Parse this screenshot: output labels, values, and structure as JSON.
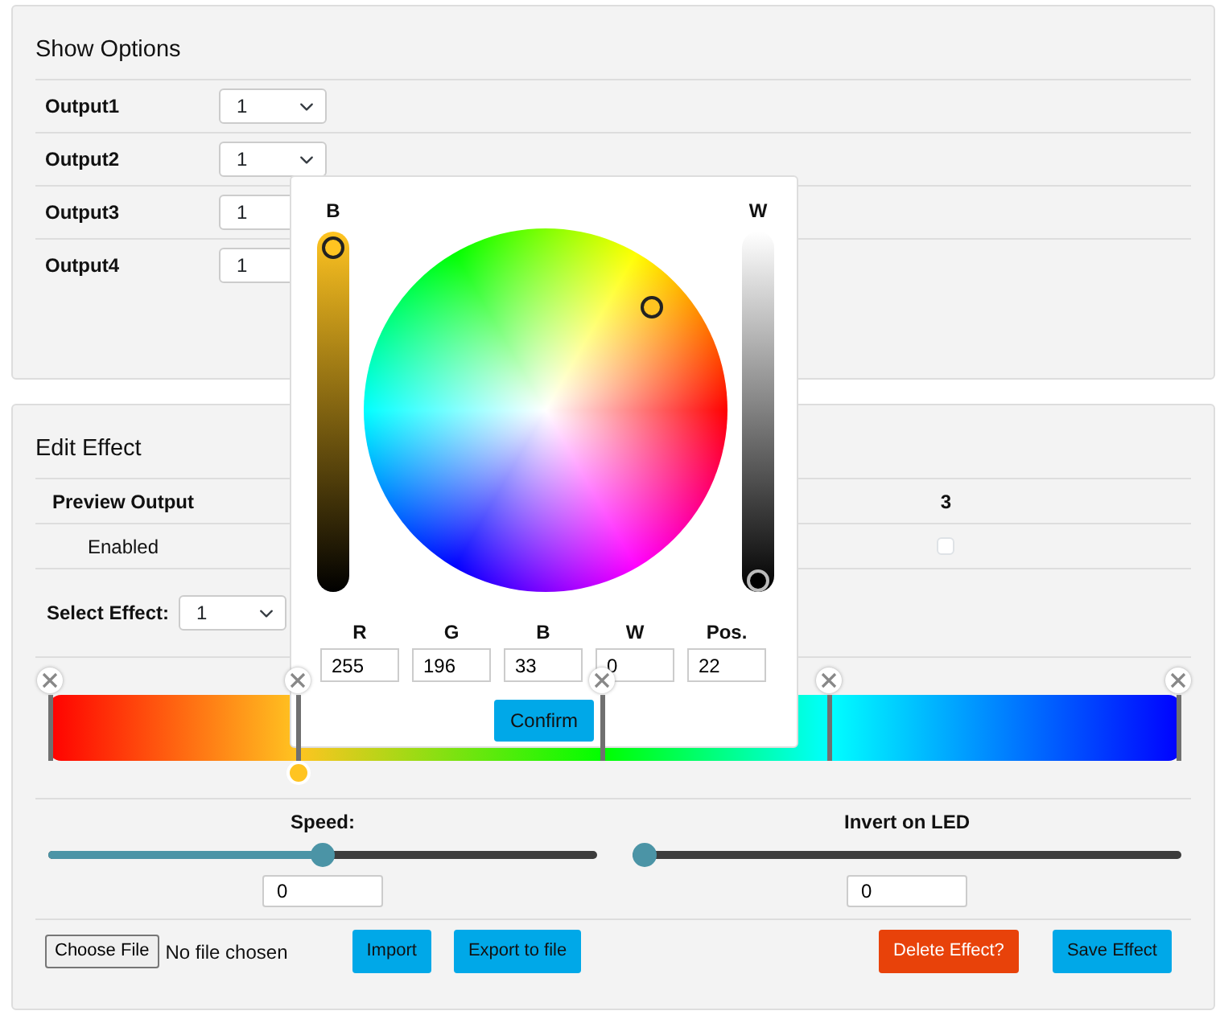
{
  "show_options": {
    "title": "Show Options",
    "outputs": [
      {
        "label": "Output1",
        "value": "1"
      },
      {
        "label": "Output2",
        "value": "1"
      },
      {
        "label": "Output3",
        "value": "1"
      },
      {
        "label": "Output4",
        "value": "1"
      }
    ]
  },
  "edit_effect": {
    "title": "Edit Effect",
    "preview": {
      "label": "Preview Output",
      "column_3": "3"
    },
    "enabled": {
      "label": "Enabled",
      "checked": false
    },
    "select_effect": {
      "label": "Select Effect:",
      "value": "1"
    },
    "gradient_stops": [
      {
        "color": "#ff0000",
        "level": 0,
        "selected": false
      },
      {
        "color": "#ffc421",
        "level": 0.22,
        "selected": true
      },
      {
        "color": "#00ff00",
        "level": 0.49,
        "selected": false
      },
      {
        "color": "#00ffff",
        "level": 0.69,
        "selected": false
      },
      {
        "color": "#0000ff",
        "level": 1,
        "selected": false
      }
    ],
    "sliders": [
      {
        "label": "Speed:",
        "level": 0.5,
        "value": "0"
      },
      {
        "label": "Invert on LED",
        "level": 0,
        "value": "0"
      }
    ],
    "file": {
      "button": "Choose File",
      "status": "No file chosen"
    },
    "buttons": [
      {
        "label": "Import",
        "kind": "primary"
      },
      {
        "label": "Export to file",
        "kind": "primary"
      },
      {
        "label": "Delete Effect?",
        "kind": "danger"
      },
      {
        "label": "Save Effect",
        "kind": "primary"
      }
    ]
  },
  "color_picker": {
    "brightness": {
      "label": "B",
      "level": 1
    },
    "white": {
      "label": "W",
      "level": 0
    },
    "fields": [
      {
        "label": "R",
        "value": "255"
      },
      {
        "label": "G",
        "value": "196"
      },
      {
        "label": "B",
        "value": "33"
      },
      {
        "label": "W",
        "value": "0"
      },
      {
        "label": "Pos.",
        "value": "22"
      }
    ],
    "confirm": "Confirm"
  }
}
